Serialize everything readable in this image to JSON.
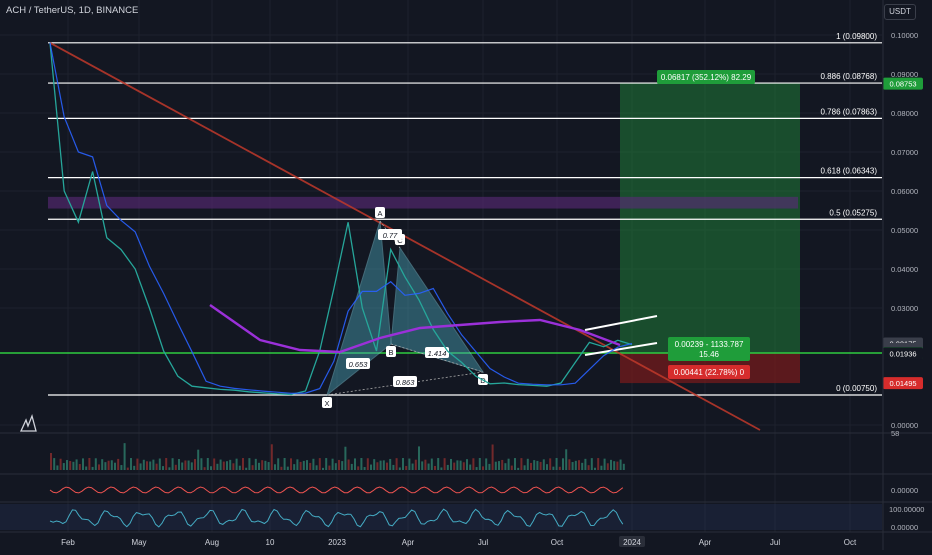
{
  "header": {
    "symbol": "ACH / TetherUS, 1D, BINANCE",
    "currency": "USDT"
  },
  "colors": {
    "bg": "#131722",
    "grid": "#1e222d",
    "axis_text": "#b2b5be",
    "fib_line": "#ffffff",
    "downtrend": "#c0392b",
    "green_box": "#1f7a36",
    "red_box": "#7a1b1b",
    "green_level": "#2ecc40",
    "purple_ma": "#9b30d9",
    "harmonic": "#4aa3b8"
  },
  "chart_data": {
    "type": "line",
    "title": "ACH / TetherUS, 1D, BINANCE",
    "x_axis": {
      "ticks": [
        "Feb",
        "May",
        "Aug",
        "10",
        "2023",
        "Apr",
        "Jul",
        "Oct",
        "2024",
        "Apr",
        "Jul",
        "Oct"
      ]
    },
    "y_axis": {
      "ticks": [
        "0.10000",
        "0.09000",
        "0.08000",
        "0.07000",
        "0.06000",
        "0.05000",
        "0.04000",
        "0.03000",
        "0.00000"
      ],
      "ylim": [
        0,
        0.1
      ]
    },
    "fib_levels": [
      {
        "label": "1 (0.09800)",
        "value": 0.098
      },
      {
        "label": "0.886 (0.08768)",
        "value": 0.08768
      },
      {
        "label": "0.786 (0.07863)",
        "value": 0.07863
      },
      {
        "label": "0.618 (0.06343)",
        "value": 0.06343
      },
      {
        "label": "0.5 (0.05275)",
        "value": 0.05275
      },
      {
        "label": "0 (0.00750)",
        "value": 0.0075
      }
    ],
    "price_badges": [
      {
        "label": "0.08753",
        "value": 0.08753,
        "color": "#1f9d3a"
      },
      {
        "label": "0.02175",
        "value": 0.02175,
        "color": "#3a3e4a"
      },
      {
        "label": "04:45:16",
        "value": 0.0205,
        "color": "#3a3e4a"
      },
      {
        "label": "0.01940",
        "value": 0.0194,
        "color": "#1f9d3a"
      },
      {
        "label": "0.01936",
        "value": 0.01936,
        "color": "#131722"
      },
      {
        "label": "0.01495",
        "value": 0.01495,
        "color": "#d62c2c"
      }
    ],
    "position": {
      "target_label": "0.06817 (352.12%) 82.29",
      "entry_label_1": "0.00239 - 1133.787",
      "entry_label_2": "15.46",
      "stop_label": "0.00441 (22.78%) 0"
    },
    "harmonic_points": [
      {
        "label": "X",
        "value": 0.0075
      },
      {
        "label": "A",
        "value": 0.0525
      },
      {
        "label": "B",
        "value": 0.0202
      },
      {
        "label": "C",
        "value": 0.0455
      },
      {
        "label": "D",
        "value": 0.0125
      }
    ],
    "harmonic_ratios": [
      "0.77",
      "0.653",
      "1.414",
      "0.863"
    ],
    "price_series": [
      0.098,
      0.06,
      0.052,
      0.065,
      0.048,
      0.045,
      0.04,
      0.03,
      0.02,
      0.016,
      0.013,
      0.012,
      0.011,
      0.0105,
      0.0095,
      0.0088,
      0.0082,
      0.0078,
      0.01,
      0.02,
      0.035,
      0.052,
      0.03,
      0.02,
      0.045,
      0.038,
      0.032,
      0.025,
      0.02,
      0.018,
      0.016,
      0.0145,
      0.015,
      0.014,
      0.0135,
      0.013,
      0.015,
      0.018,
      0.022,
      0.021,
      0.0225,
      0.0215
    ],
    "volume_scale": "58",
    "osc1_label": "0.00000",
    "osc2_top": "100.00000",
    "osc2_bottom": "0.00000"
  }
}
